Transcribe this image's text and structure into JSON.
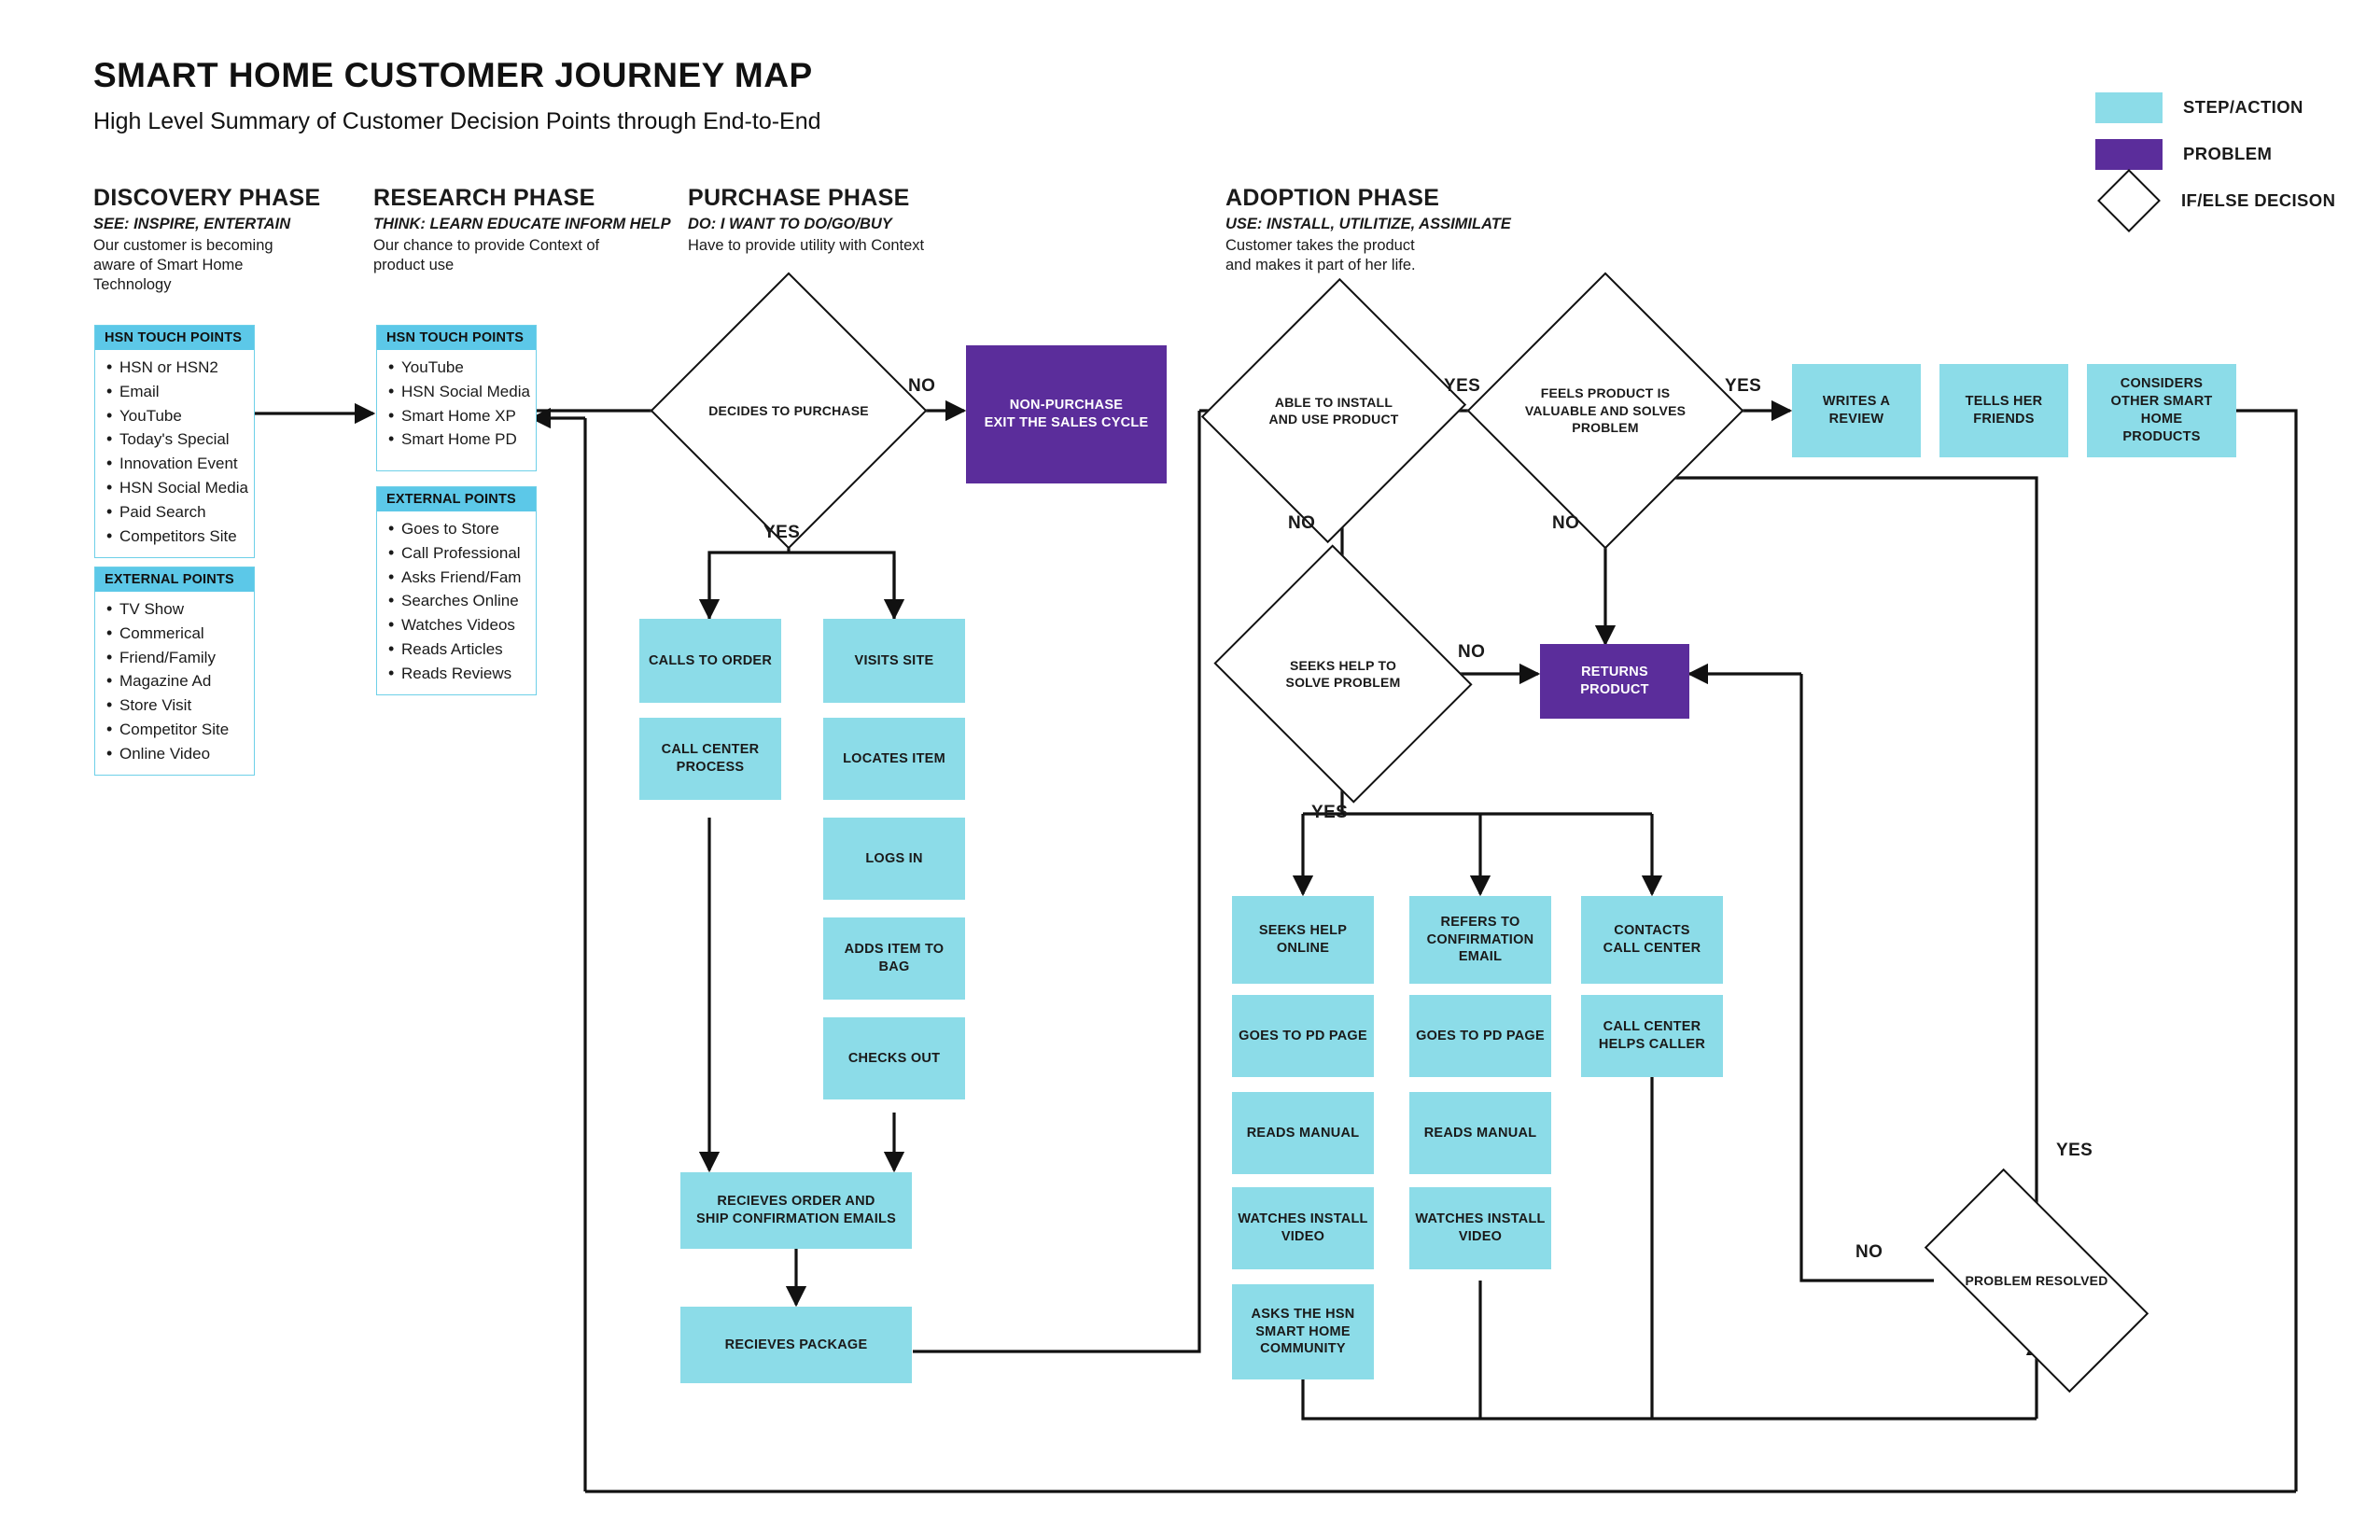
{
  "header": {
    "title": "SMART HOME CUSTOMER JOURNEY MAP",
    "subtitle": "High Level Summary of Customer Decision Points through End-to-End"
  },
  "legend": {
    "items": [
      {
        "label": "STEP/ACTION",
        "color": "#8CDCE8",
        "shape": "square"
      },
      {
        "label": "PROBLEM",
        "color": "#5B2D9B",
        "shape": "square"
      },
      {
        "label": "IF/ELSE DECISON",
        "color": "#FFFFFF",
        "shape": "diamond"
      }
    ]
  },
  "phases": [
    {
      "title": "DISCOVERY PHASE",
      "verb": "SEE: INSPIRE, ENTERTAIN",
      "description": "Our customer is becoming\naware of Smart Home\nTechnology"
    },
    {
      "title": "RESEARCH PHASE",
      "verb": "THINK: LEARN EDUCATE INFORM HELP",
      "description": "Our chance to provide Context of\nproduct use"
    },
    {
      "title": "PURCHASE PHASE",
      "verb": "DO: I WANT TO DO/GO/BUY",
      "description": "Have to provide utility with Context"
    },
    {
      "title": "ADOPTION PHASE",
      "verb": "USE: INSTALL, UTILITIZE, ASSIMILATE",
      "description": "Customer takes the product\nand makes it part of her life."
    }
  ],
  "cards": [
    {
      "id": "discovery-hsn",
      "header": "HSN TOUCH POINTS",
      "items": [
        "HSN or HSN2",
        "Email",
        "YouTube",
        "Today's Special",
        "Innovation Event",
        "HSN Social Media",
        "Paid Search",
        "Competitors Site"
      ]
    },
    {
      "id": "discovery-external",
      "header": "EXTERNAL POINTS",
      "items": [
        "TV Show",
        "Commerical",
        "Friend/Family",
        "Magazine Ad",
        "Store Visit",
        "Competitor Site",
        "Online Video"
      ]
    },
    {
      "id": "research-hsn",
      "header": "HSN TOUCH POINTS",
      "items": [
        "YouTube",
        "HSN Social Media",
        "Smart Home XP",
        "Smart Home PD"
      ]
    },
    {
      "id": "research-external",
      "header": "EXTERNAL POINTS",
      "items": [
        "Goes to Store",
        "Call Professional",
        "Asks Friend/Fam",
        "Searches Online",
        "Watches Videos",
        "Reads Articles",
        "Reads Reviews"
      ]
    }
  ],
  "nodes": {
    "decides_to_purchase": "DECIDES TO PURCHASE",
    "non_purchase": "NON-PURCHASE\nEXIT THE SALES CYCLE",
    "calls_to_order": "CALLS TO ORDER",
    "call_center_process": "CALL CENTER\nPROCESS",
    "visits_site": "VISITS SITE",
    "locates_item": "LOCATES ITEM",
    "logs_in": "LOGS IN",
    "adds_item_to_bag": "ADDS ITEM TO BAG",
    "checks_out": "CHECKS OUT",
    "recieves_order": "RECIEVES ORDER AND\nSHIP CONFIRMATION EMAILS",
    "recieves_package": "RECIEVES PACKAGE",
    "able_to_install": "ABLE TO INSTALL\nAND  USE PRODUCT",
    "feels_product_valuable": "FEELS PRODUCT IS\nVALUABLE AND SOLVES\nPROBLEM",
    "seeks_help_to_solve": "SEEKS HELP TO\nSOLVE PROBLEM",
    "returns_product": "RETURNS PRODUCT",
    "writes_a_review": "WRITES A\nREVIEW",
    "tells_her_friends": "TELLS HER\nFRIENDS",
    "considers_other": "CONSIDERS\nOTHER SMART HOME\nPRODUCTS",
    "seeks_help_online": "SEEKS HELP\nONLINE",
    "goes_to_pd_page_1": "GOES TO PD PAGE",
    "reads_manual_1": "READS MANUAL",
    "watches_install_video_1": "WATCHES INSTALL\nVIDEO",
    "asks_community": "ASKS THE HSN\nSMART HOME\nCOMMUNITY",
    "refers_to_confirmation": "REFERS TO\nCONFIRMATION\nEMAIL",
    "goes_to_pd_page_2": "GOES TO PD PAGE",
    "reads_manual_2": "READS MANUAL",
    "watches_install_video_2": "WATCHES INSTALL\nVIDEO",
    "contacts_call_center": "CONTACTS\nCALL CENTER",
    "call_center_helps": "CALL CENTER\nHELPS CALLER",
    "problem_resolved": "PROBLEM RESOLVED"
  },
  "edge_labels": {
    "purchase_no": "NO",
    "purchase_yes": "YES",
    "install_yes": "YES",
    "install_no": "NO",
    "valuable_yes": "YES",
    "valuable_no": "NO",
    "seeks_help_no": "NO",
    "seeks_help_yes": "YES",
    "resolved_yes": "YES",
    "resolved_no": "NO"
  },
  "colors": {
    "step": "#8CDCE8",
    "problem": "#5B2D9B",
    "card_header": "#5CC8E8",
    "card_border": "#6ED0E8",
    "line": "#111111"
  }
}
